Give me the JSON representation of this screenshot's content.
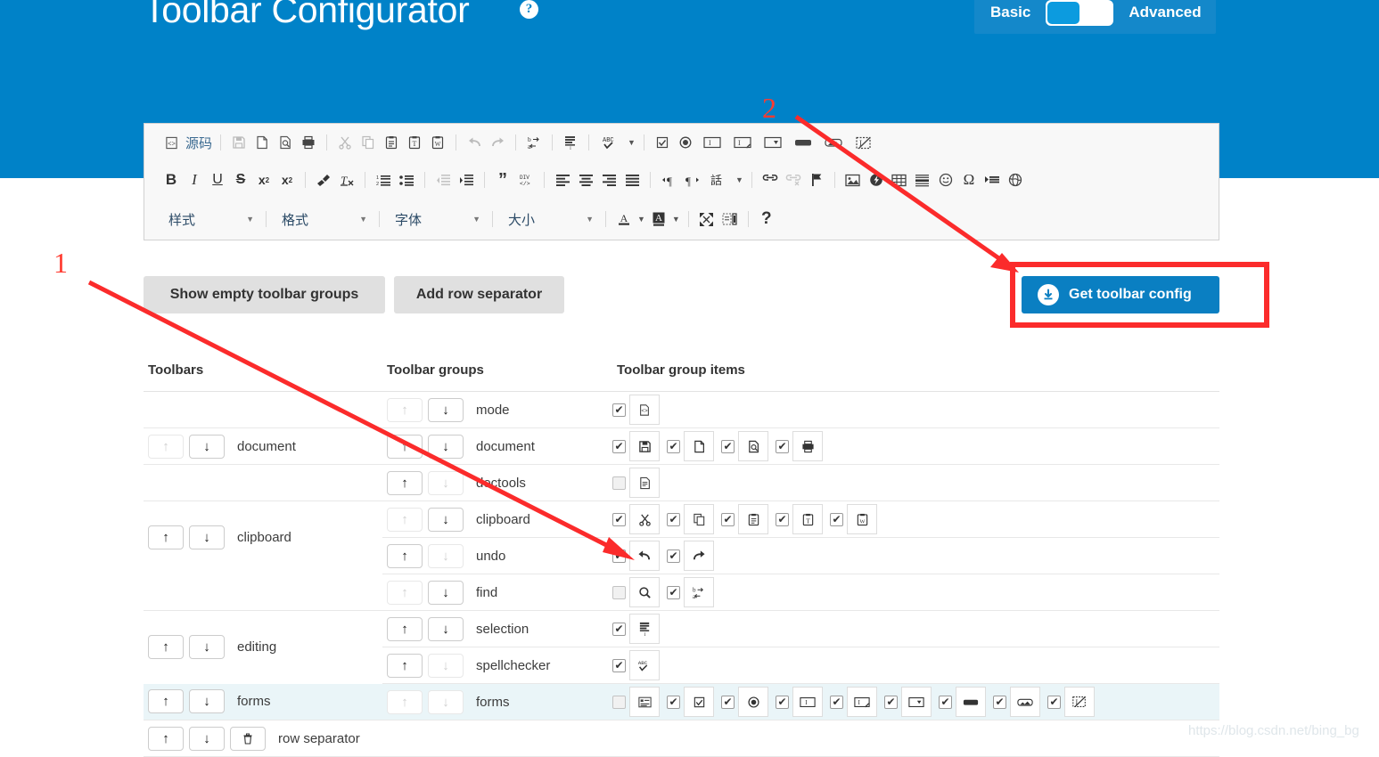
{
  "header": {
    "title": "Toolbar Configurator",
    "help_icon": "question-mark-icon",
    "mode_basic": "Basic",
    "mode_advanced": "Advanced",
    "active_mode": "Basic",
    "bg_color": "#0082c8"
  },
  "editor_toolbar": {
    "rows": [
      {
        "groups": [
          {
            "items": [
              {
                "icon": "source-icon",
                "label": "源码",
                "dim": false
              }
            ]
          },
          {
            "items": [
              {
                "icon": "save-icon",
                "dim": true
              },
              {
                "icon": "new-page-icon",
                "dim": false
              },
              {
                "icon": "preview-icon",
                "dim": false
              },
              {
                "icon": "print-icon",
                "dim": false
              }
            ]
          },
          {
            "items": [
              {
                "icon": "cut-icon",
                "dim": true
              },
              {
                "icon": "copy-icon",
                "dim": true
              },
              {
                "icon": "paste-icon",
                "dim": false
              },
              {
                "icon": "paste-text-icon",
                "dim": false
              },
              {
                "icon": "paste-word-icon",
                "dim": false
              }
            ]
          },
          {
            "items": [
              {
                "icon": "undo-icon",
                "dim": true
              },
              {
                "icon": "redo-icon",
                "dim": true
              }
            ]
          },
          {
            "items": [
              {
                "icon": "replace-icon",
                "dim": false
              }
            ]
          },
          {
            "items": [
              {
                "icon": "select-all-icon",
                "dim": false
              }
            ]
          },
          {
            "items": [
              {
                "icon": "spellchecker-icon",
                "dim": false,
                "caret": true
              }
            ]
          },
          {
            "items": [
              {
                "icon": "checkbox-field-icon",
                "dim": false
              },
              {
                "icon": "radio-field-icon",
                "dim": false
              },
              {
                "icon": "text-field-icon",
                "dim": false
              },
              {
                "icon": "textarea-icon",
                "dim": false
              },
              {
                "icon": "select-field-icon",
                "dim": false
              },
              {
                "icon": "button-icon",
                "dim": false
              },
              {
                "icon": "image-button-icon",
                "dim": false
              },
              {
                "icon": "hidden-field-icon",
                "dim": false
              }
            ]
          }
        ]
      },
      {
        "groups": [
          {
            "items": [
              {
                "icon": "bold-icon"
              },
              {
                "icon": "italic-icon"
              },
              {
                "icon": "underline-icon"
              },
              {
                "icon": "strike-icon"
              },
              {
                "icon": "subscript-icon"
              },
              {
                "icon": "superscript-icon"
              }
            ]
          },
          {
            "items": [
              {
                "icon": "copy-formatting-icon"
              },
              {
                "icon": "remove-format-icon"
              }
            ]
          },
          {
            "items": [
              {
                "icon": "numbered-list-icon"
              },
              {
                "icon": "bulleted-list-icon"
              }
            ]
          },
          {
            "items": [
              {
                "icon": "outdent-icon",
                "dim": true
              },
              {
                "icon": "indent-icon"
              }
            ]
          },
          {
            "items": [
              {
                "icon": "blockquote-icon"
              },
              {
                "icon": "create-div-icon"
              }
            ]
          },
          {
            "items": [
              {
                "icon": "align-left-icon"
              },
              {
                "icon": "align-center-icon"
              },
              {
                "icon": "align-right-icon"
              },
              {
                "icon": "justify-icon"
              }
            ]
          },
          {
            "items": [
              {
                "icon": "ltr-icon"
              },
              {
                "icon": "rtl-icon"
              },
              {
                "icon": "language-icon",
                "caret": true
              }
            ]
          },
          {
            "items": [
              {
                "icon": "link-icon"
              },
              {
                "icon": "unlink-icon",
                "dim": true
              },
              {
                "icon": "anchor-icon"
              }
            ]
          },
          {
            "items": [
              {
                "icon": "image-icon"
              },
              {
                "icon": "flash-icon"
              },
              {
                "icon": "table-icon"
              },
              {
                "icon": "horizontal-rule-icon"
              },
              {
                "icon": "smiley-icon"
              },
              {
                "icon": "special-char-icon"
              },
              {
                "icon": "page-break-icon"
              },
              {
                "icon": "iframe-icon"
              }
            ]
          }
        ]
      },
      {
        "combos": [
          "样式",
          "格式",
          "字体",
          "大小"
        ],
        "groups": [
          {
            "items": [
              {
                "icon": "text-color-icon",
                "caret": true
              },
              {
                "icon": "bg-color-icon",
                "caret": true
              }
            ]
          },
          {
            "items": [
              {
                "icon": "maximize-icon"
              },
              {
                "icon": "show-blocks-icon"
              }
            ]
          },
          {
            "items": [
              {
                "icon": "about-icon"
              }
            ]
          }
        ]
      }
    ]
  },
  "actions": {
    "show_empty_groups": "Show empty toolbar groups",
    "add_row_separator": "Add row separator",
    "get_toolbar_config": "Get toolbar config",
    "get_config_icon": "download-circle-icon",
    "get_config_color": "#0a7fc2"
  },
  "table": {
    "headers": [
      "Toolbars",
      "Toolbar groups",
      "Toolbar group items"
    ],
    "rows": [
      {
        "toolbar": null,
        "group": {
          "name": "mode",
          "up_enabled": false,
          "down_enabled": true
        },
        "items": [
          {
            "checked": true,
            "icon": "source-icon"
          }
        ],
        "highlight": false
      },
      {
        "toolbar": {
          "name": "document",
          "up_enabled": false,
          "down_enabled": true
        },
        "group": {
          "name": "document",
          "up_enabled": true,
          "down_enabled": true
        },
        "items": [
          {
            "checked": true,
            "icon": "save-icon"
          },
          {
            "checked": true,
            "icon": "new-page-icon"
          },
          {
            "checked": true,
            "icon": "preview-icon"
          },
          {
            "checked": true,
            "icon": "print-icon"
          }
        ],
        "highlight": false
      },
      {
        "toolbar": null,
        "group": {
          "name": "doctools",
          "up_enabled": true,
          "down_enabled": false
        },
        "items": [
          {
            "checked": false,
            "icon": "templates-icon"
          }
        ],
        "highlight": false
      },
      {
        "toolbar": {
          "name": "clipboard",
          "up_enabled": true,
          "down_enabled": true
        },
        "group": {
          "name": "clipboard",
          "up_enabled": false,
          "down_enabled": true
        },
        "items": [
          {
            "checked": true,
            "icon": "cut-icon"
          },
          {
            "checked": true,
            "icon": "copy-icon"
          },
          {
            "checked": true,
            "icon": "paste-icon"
          },
          {
            "checked": true,
            "icon": "paste-text-icon"
          },
          {
            "checked": true,
            "icon": "paste-word-icon"
          }
        ],
        "highlight": false
      },
      {
        "toolbar": null,
        "group": {
          "name": "undo",
          "up_enabled": true,
          "down_enabled": false
        },
        "items": [
          {
            "checked": true,
            "icon": "undo-icon"
          },
          {
            "checked": true,
            "icon": "redo-icon"
          }
        ],
        "highlight": false
      },
      {
        "toolbar": null,
        "group": {
          "name": "find",
          "up_enabled": false,
          "down_enabled": true
        },
        "items": [
          {
            "checked": false,
            "icon": "find-icon"
          },
          {
            "checked": true,
            "icon": "replace-icon"
          }
        ],
        "highlight": false
      },
      {
        "toolbar": {
          "name": "editing",
          "up_enabled": true,
          "down_enabled": true
        },
        "group": {
          "name": "selection",
          "up_enabled": true,
          "down_enabled": true
        },
        "items": [
          {
            "checked": true,
            "icon": "select-all-icon"
          }
        ],
        "highlight": false
      },
      {
        "toolbar": null,
        "group": {
          "name": "spellchecker",
          "up_enabled": true,
          "down_enabled": false
        },
        "items": [
          {
            "checked": true,
            "icon": "spellchecker-icon"
          }
        ],
        "highlight": false
      },
      {
        "toolbar": {
          "name": "forms",
          "up_enabled": true,
          "down_enabled": true
        },
        "group": {
          "name": "forms",
          "up_enabled": false,
          "down_enabled": false
        },
        "items": [
          {
            "checked": false,
            "icon": "form-icon"
          },
          {
            "checked": true,
            "icon": "checkbox-field-icon"
          },
          {
            "checked": true,
            "icon": "radio-field-icon"
          },
          {
            "checked": true,
            "icon": "text-field-icon"
          },
          {
            "checked": true,
            "icon": "textarea-icon"
          },
          {
            "checked": true,
            "icon": "select-field-icon"
          },
          {
            "checked": true,
            "icon": "button-icon"
          },
          {
            "checked": true,
            "icon": "image-button-icon"
          },
          {
            "checked": true,
            "icon": "hidden-field-icon"
          }
        ],
        "highlight": true
      },
      {
        "toolbar": {
          "name": "row separator",
          "up_enabled": true,
          "down_enabled": true,
          "deletable": true
        },
        "group": null,
        "items": [],
        "highlight": false
      }
    ]
  },
  "annotations": {
    "marker_1": "1",
    "marker_2": "2",
    "color": "#ff3b30"
  },
  "watermark": "https://blog.csdn.net/bing_bg"
}
